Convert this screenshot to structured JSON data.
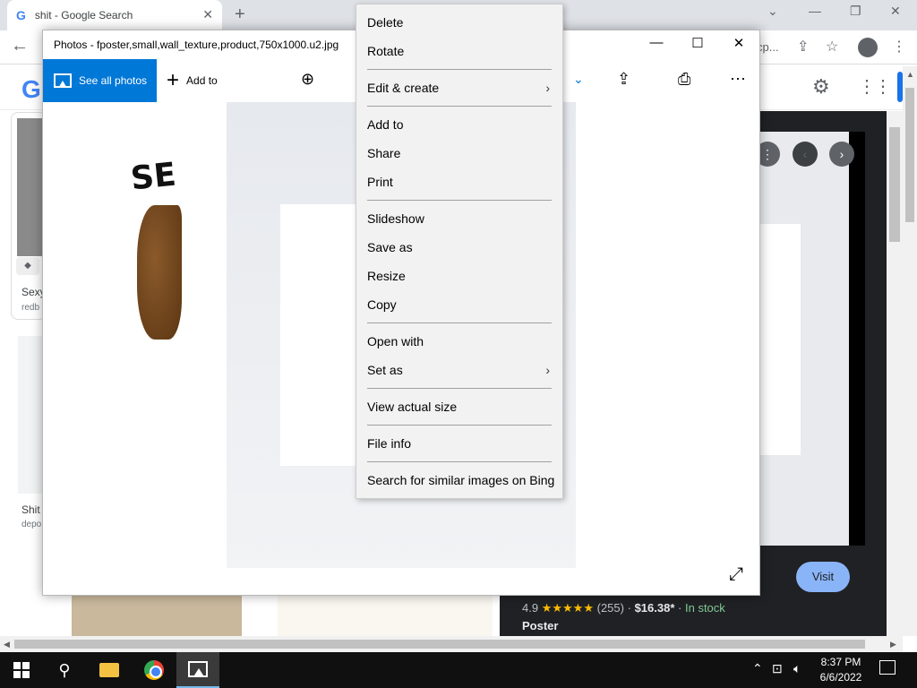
{
  "chrome": {
    "tab_title": "shit - Google Search",
    "tab_favicon": "G",
    "omnibox_text": "cp...",
    "google_logo": "G"
  },
  "results": [
    {
      "title": "Sexy",
      "source": "redb"
    },
    {
      "title": "Shit",
      "source": "depo"
    }
  ],
  "preview": {
    "visit_label": "Visit",
    "rating": "4.9",
    "stars": "★★★★★",
    "review_count": "(255)",
    "price": "$16.38*",
    "stock": "In stock",
    "type": "Poster",
    "sep": "·"
  },
  "photos": {
    "title": "Photos - fposter,small,wall_texture,product,750x1000.u2.jpg",
    "see_all": "See all photos",
    "add_to": "Add to",
    "poster_text": "SE"
  },
  "context_menu": {
    "delete": "Delete",
    "rotate": "Rotate",
    "edit_create": "Edit & create",
    "add_to": "Add to",
    "share": "Share",
    "print": "Print",
    "slideshow": "Slideshow",
    "save_as": "Save as",
    "resize": "Resize",
    "copy": "Copy",
    "open_with": "Open with",
    "set_as": "Set as",
    "view_actual_size": "View actual size",
    "file_info": "File info",
    "search_bing": "Search for similar images on Bing"
  },
  "taskbar": {
    "time": "8:37 PM",
    "date": "6/6/2022"
  },
  "colors": {
    "accent": "#0078d7",
    "menu_bg": "#f2f2f2",
    "star": "#fbbc04",
    "in_stock": "#81c995",
    "visit_button": "#8ab4f8"
  }
}
